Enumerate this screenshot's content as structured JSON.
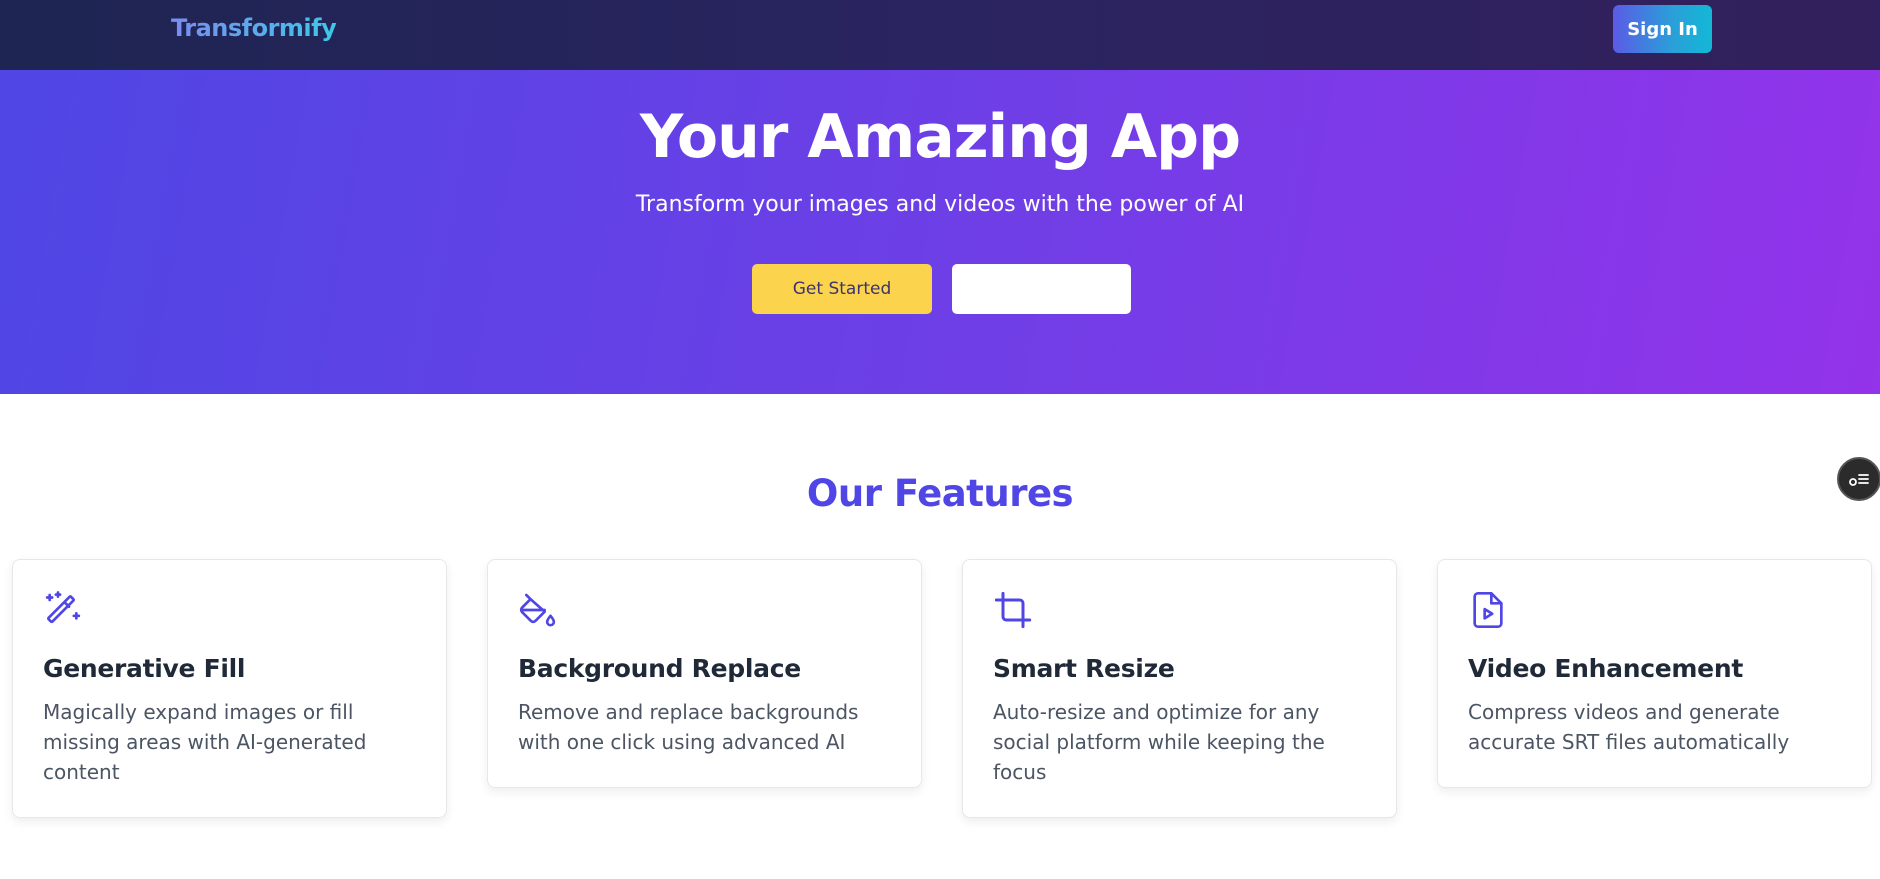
{
  "navbar": {
    "brand": "Transformify",
    "signin_label": "Sign In"
  },
  "hero": {
    "title": "Your Amazing App",
    "subtitle": "Transform your images and videos with the power of AI",
    "primary_button": "Get Started",
    "secondary_button": ""
  },
  "features": {
    "title": "Our Features",
    "items": [
      {
        "icon": "magic-wand-icon",
        "title": "Generative Fill",
        "description": "Magically expand images or fill missing areas with AI-generated content"
      },
      {
        "icon": "paint-bucket-icon",
        "title": "Background Replace",
        "description": "Remove and replace backgrounds with one click using advanced AI"
      },
      {
        "icon": "crop-icon",
        "title": "Smart Resize",
        "description": "Auto-resize and optimize for any social platform while keeping the focus"
      },
      {
        "icon": "video-file-icon",
        "title": "Video Enhancement",
        "description": "Compress videos and generate accurate SRT files automatically"
      }
    ]
  },
  "colors": {
    "accent": "#4f46e5",
    "primary_button": "#fcd34d",
    "hero_start": "#4f46e5",
    "hero_end": "#9333ea",
    "navbar": "#1e2552"
  }
}
